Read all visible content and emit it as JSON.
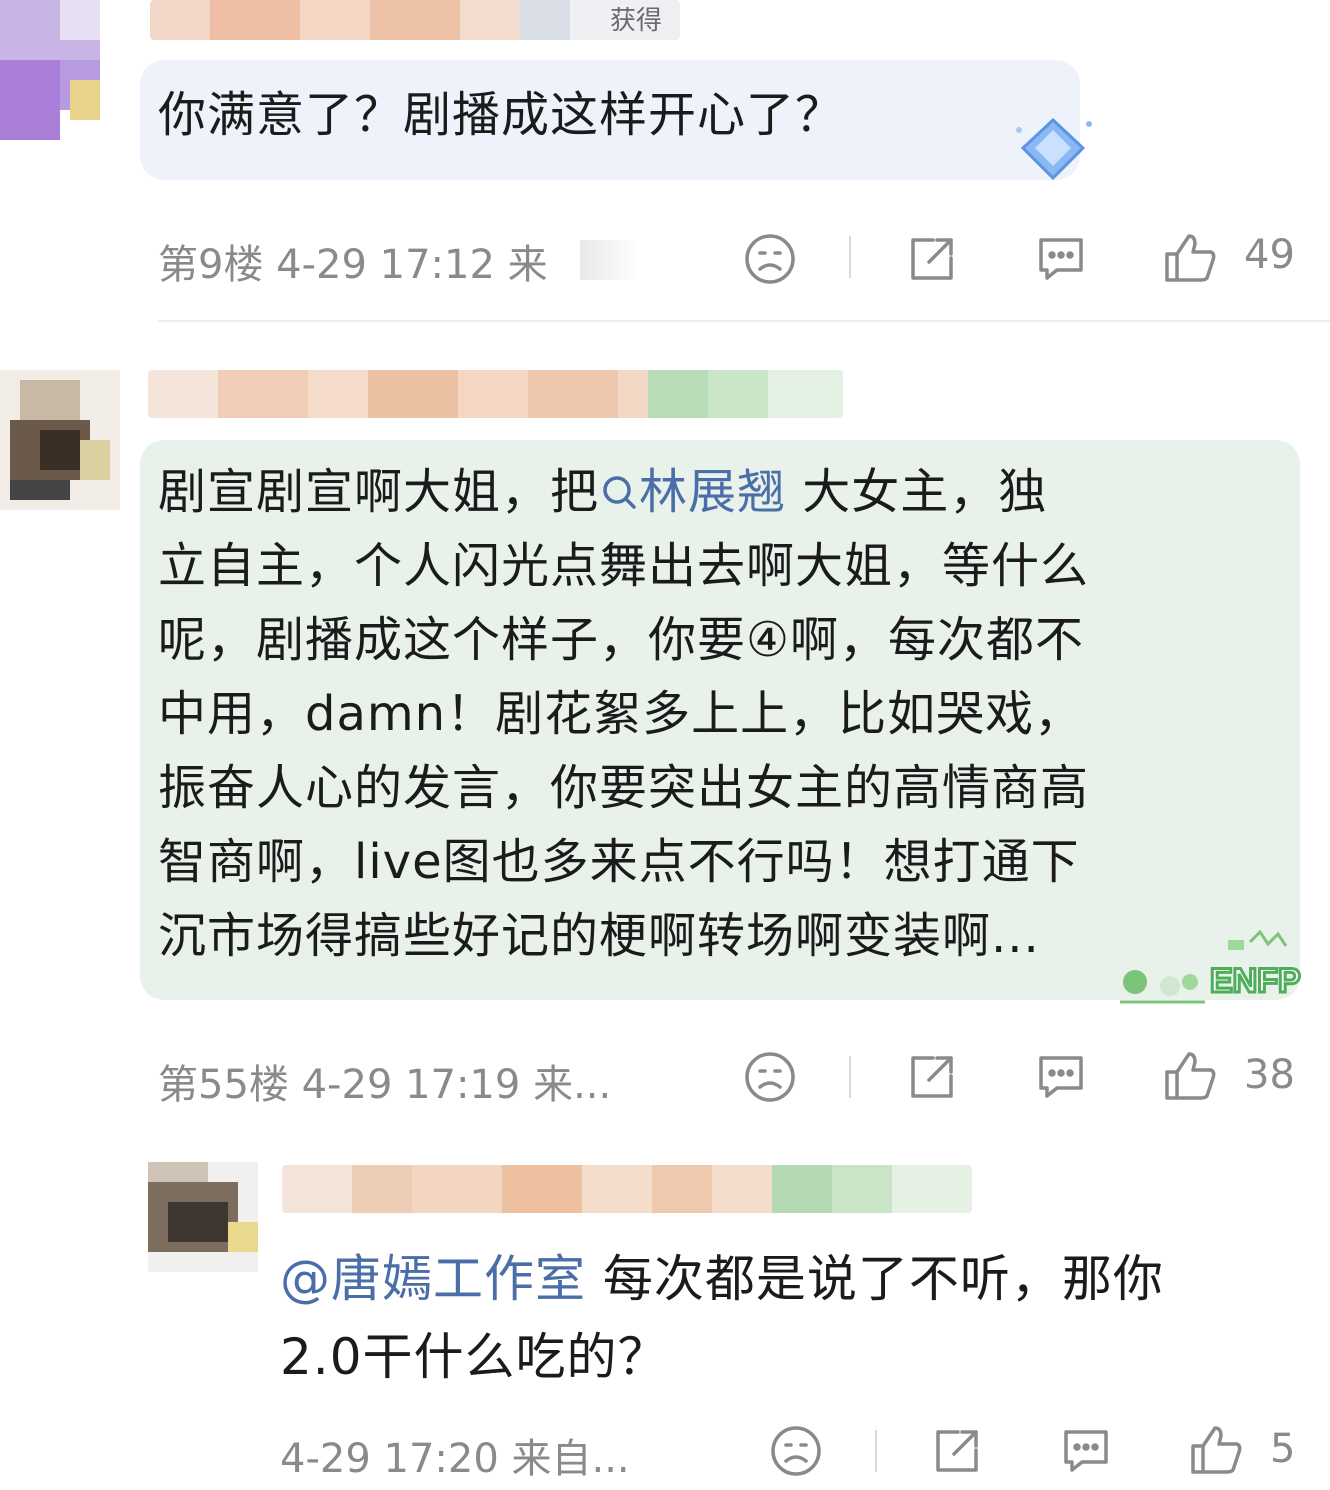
{
  "comments": [
    {
      "text": "你满意了？剧播成这样开心了？",
      "meta": "第9楼 4-29 17:12 来",
      "likes": "49",
      "badge_text": "获得"
    },
    {
      "text_lines": [
        "剧宣剧宣啊大姐，把",
        "林展翘",
        " 大女主，独",
        "立自主，个人闪光点舞出去啊大姐，等什么",
        "呢，剧播成这个样子，你要④啊，每次都不",
        "中用，damn！剧花絮多上上，比如哭戏，",
        "振奋人心的发言，你要突出女主的高情商高",
        "智商啊，live图也多来点不行吗！想打通下",
        "沉市场得搞些好记的梗啊转场啊变装啊..."
      ],
      "meta": "第55楼 4-29 17:19 来...",
      "likes": "38",
      "badge_text": "ENFP"
    },
    {
      "mention": "@唐嫣工作室",
      "text_line1": " 每次都是说了不听，那你",
      "text_line2": "2.0干什么吃的？",
      "meta": "4-29 17:20 来自...",
      "likes": "5"
    }
  ],
  "icons": {
    "dislike": "sad-face-icon",
    "share": "share-icon",
    "comment": "comment-icon",
    "like": "thumbs-up-icon",
    "search": "search-icon"
  },
  "colors": {
    "link": "#4a6ea8",
    "meta": "#8a8a8a",
    "bubble_blue": "#eef2fb",
    "bubble_green": "#e8f1ea"
  }
}
